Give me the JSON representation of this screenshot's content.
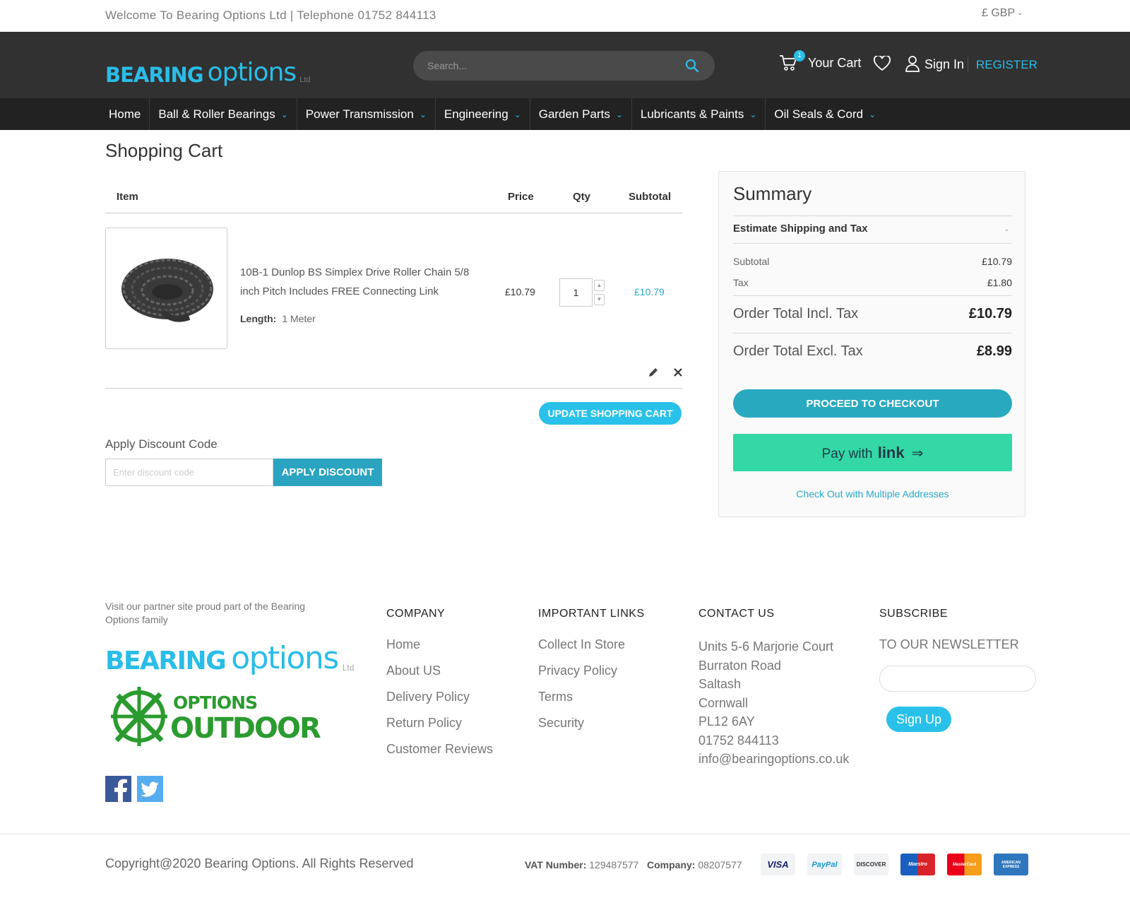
{
  "topbar": {
    "welcome": "Welcome To Bearing Options Ltd | Telephone 01752 844113",
    "currency": "£ GBP"
  },
  "header": {
    "logo_bold": "BEARING",
    "logo_light": "options",
    "logo_ltd": "Ltd",
    "search_placeholder": "Search...",
    "cart_count": "1",
    "cart_label": "Your Cart",
    "sign_in": "Sign In",
    "register": "REGISTER"
  },
  "nav": [
    {
      "label": "Home",
      "dropdown": false
    },
    {
      "label": "Ball & Roller Bearings",
      "dropdown": true
    },
    {
      "label": "Power Transmission",
      "dropdown": true
    },
    {
      "label": "Engineering",
      "dropdown": true
    },
    {
      "label": "Garden Parts",
      "dropdown": true
    },
    {
      "label": "Lubricants & Paints",
      "dropdown": true
    },
    {
      "label": "Oil Seals & Cord",
      "dropdown": true
    }
  ],
  "cart": {
    "title": "Shopping Cart",
    "columns": {
      "item": "Item",
      "price": "Price",
      "qty": "Qty",
      "subtotal": "Subtotal"
    },
    "items": [
      {
        "name": "10B-1 Dunlop BS Simplex Drive Roller Chain 5/8 inch Pitch Includes FREE Connecting Link",
        "option_label": "Length:",
        "option_value": "1 Meter",
        "price": "£10.79",
        "qty": "1",
        "subtotal": "£10.79"
      }
    ],
    "update_button": "Update Shopping Cart",
    "discount_title": "Apply Discount Code",
    "discount_placeholder": "Enter discount code",
    "discount_button": "APPLY DISCOUNT"
  },
  "summary": {
    "title": "Summary",
    "estimate": "Estimate Shipping and Tax",
    "subtotal_label": "Subtotal",
    "subtotal_value": "£10.79",
    "tax_label": "Tax",
    "tax_value": "£1.80",
    "incl_label": "Order Total Incl. Tax",
    "incl_value": "£10.79",
    "excl_label": "Order Total Excl. Tax",
    "excl_value": "£8.99",
    "checkout_button": "PROCEED TO CHECKOUT",
    "link_prefix": "Pay with",
    "link_brand": "link",
    "multi_address": "Check Out with Multiple Addresses"
  },
  "footer": {
    "partner_text": "Visit our partner site proud part of the Bearing Options family",
    "partner_logo_bold": "BEARING",
    "partner_logo_light": "options",
    "partner_logo_ltd": "Ltd",
    "outdoor_top": "OPTIONS",
    "outdoor_bottom": "OUTDOOR",
    "company_title": "COMPANY",
    "company_links": [
      "Home",
      "About US",
      "Delivery Policy",
      "Return Policy",
      "Customer Reviews"
    ],
    "links_title": "IMPORTANT LINKS",
    "important_links": [
      "Collect In Store",
      "Privacy Policy",
      "Terms",
      "Security"
    ],
    "contact_title": "CONTACT US",
    "contact_lines": [
      "Units 5-6 Marjorie Court",
      "Burraton Road",
      "Saltash",
      "Cornwall",
      "PL12 6AY",
      "01752 844113",
      "info@bearingoptions.co.uk"
    ],
    "subscribe_title": "SUBSCRIBE",
    "newsletter": "TO OUR NEWSLETTER",
    "signup_button": "Sign Up",
    "copyright": "Copyright@2020 Bearing Options. All Rights Reserved",
    "vat_label": "VAT Number:",
    "vat_value": "129487577",
    "company_label": "Company:",
    "company_value": "08207577",
    "payment_icons": [
      "VISA",
      "PayPal",
      "DISCOVER",
      "Maestro",
      "MasterCard",
      "AMERICAN EXPRESS"
    ]
  },
  "colors": {
    "accent": "#29bde8",
    "header_bg": "#313131",
    "nav_bg": "#222222",
    "checkout": "#29a9c0",
    "link_pay": "#33d8a6"
  }
}
